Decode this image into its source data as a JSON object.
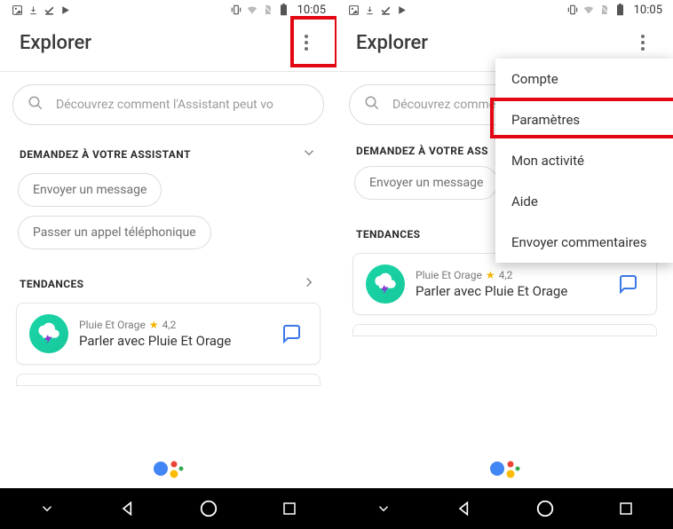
{
  "status": {
    "time": "10:05"
  },
  "header": {
    "title": "Explorer"
  },
  "search": {
    "placeholder": "Découvrez comment l'Assistant peut vo"
  },
  "sections": {
    "assistant": {
      "title": "DEMANDEZ À VOTRE ASSISTANT",
      "title_truncated": "DEMANDEZ À VOTRE ASS",
      "chips": [
        "Envoyer un message",
        "Passer un appel téléphonique"
      ],
      "chip_truncated_0": "Envoyer un message",
      "chip_truncated_1": "Passer un appel télé"
    },
    "trends": {
      "title": "TENDANCES",
      "card": {
        "app": "Pluie Et Orage",
        "rating": "4,2",
        "action_label": "Parler avec Pluie Et Orage"
      }
    }
  },
  "menu": {
    "items": [
      "Compte",
      "Paramètres",
      "Mon activité",
      "Aide",
      "Envoyer commentaires"
    ]
  }
}
